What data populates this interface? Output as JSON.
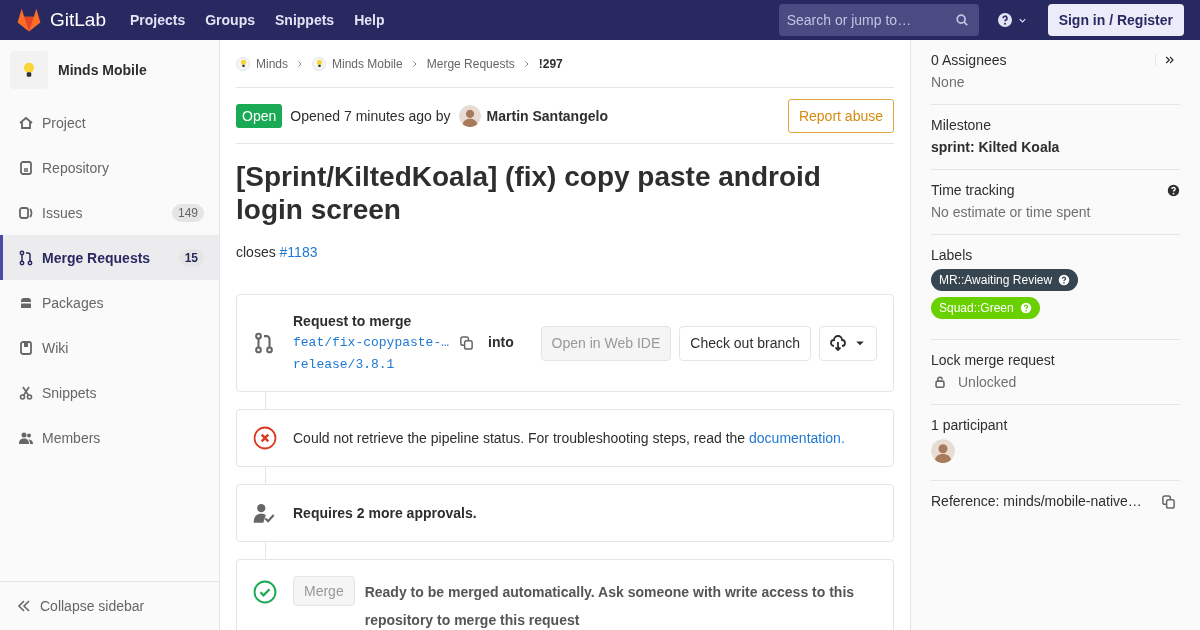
{
  "navbar": {
    "brand": "GitLab",
    "links": [
      "Projects",
      "Groups",
      "Snippets",
      "Help"
    ],
    "search": {
      "placeholder": "Search or jump to…"
    },
    "sign_in": "Sign in / Register"
  },
  "sidebar": {
    "project": "Minds Mobile",
    "items": [
      {
        "label": "Project",
        "selected": false
      },
      {
        "label": "Repository",
        "selected": false
      },
      {
        "label": "Issues",
        "count": "149",
        "selected": false
      },
      {
        "label": "Merge Requests",
        "count": "15",
        "selected": true
      },
      {
        "label": "Packages",
        "selected": false
      },
      {
        "label": "Wiki",
        "selected": false
      },
      {
        "label": "Snippets",
        "selected": false
      },
      {
        "label": "Members",
        "selected": false
      }
    ],
    "collapse": "Collapse sidebar"
  },
  "breadcrumbs": [
    {
      "label": "Minds",
      "kind": "avatar"
    },
    {
      "label": "Minds Mobile",
      "kind": "avatar"
    },
    {
      "label": "Merge Requests",
      "kind": "plain"
    },
    {
      "label": "!297",
      "kind": "current"
    }
  ],
  "issuable": {
    "status": "Open",
    "opened": "Opened 7 minutes ago by",
    "author": "Martin Santangelo",
    "report": "Report abuse",
    "title": "[Sprint/KiltedKoala] (fix) copy paste android login screen",
    "description": "closes",
    "link": "#1183"
  },
  "widgets": [
    {
      "kind": "branch",
      "title": "Request to merge",
      "source": "feat/fix-copypaste-…",
      "into": "into",
      "target": "release/3.8.1",
      "buttons": [
        {
          "label": "Open in Web IDE",
          "disabled": true
        },
        {
          "label": "Check out branch",
          "disabled": false
        }
      ]
    },
    {
      "kind": "pipeline",
      "text": "Could not retrieve the pipeline status. For troubleshooting steps, read the",
      "link": "documentation."
    },
    {
      "kind": "approvals",
      "text": "Requires 2 more approvals."
    },
    {
      "kind": "merge",
      "button": {
        "label": "Merge",
        "disabled": true
      },
      "text": "Ready to be merged automatically. Ask someone with write access to this repository to merge this request"
    }
  ],
  "right_sidebar": [
    {
      "kind": "assignees",
      "title": "0 Assignees",
      "value": "None"
    },
    {
      "kind": "milestone",
      "title": "Milestone",
      "value": "sprint: Kilted Koala"
    },
    {
      "kind": "time",
      "title": "Time tracking",
      "value": "No estimate or time spent"
    },
    {
      "kind": "labels",
      "title": "Labels",
      "labels": [
        {
          "text": "MR::Awaiting Review",
          "color": "#36454f"
        },
        {
          "text": "Squad::Green",
          "color": "#69d100"
        }
      ]
    },
    {
      "kind": "lock",
      "title": "Lock merge request",
      "value": "Unlocked"
    },
    {
      "kind": "participants",
      "title": "1 participant"
    },
    {
      "kind": "reference",
      "title": "Reference: minds/mobile-native…"
    }
  ]
}
